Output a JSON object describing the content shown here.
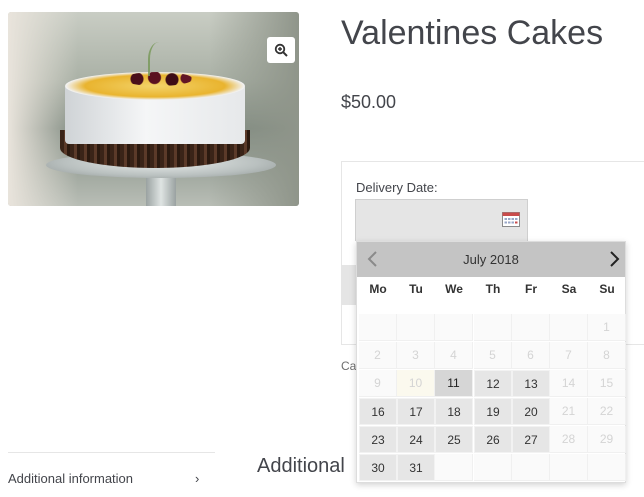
{
  "product": {
    "title": "Valentines Cakes",
    "price": "$50.00",
    "image_alt": "cake"
  },
  "addon": {
    "delivery_label": "Delivery Date:",
    "date_value": ""
  },
  "meta": {
    "category_fragment": "Cat"
  },
  "tabs": {
    "additional_information": "Additional information",
    "chevron": "›"
  },
  "section_heading": "Additional",
  "datepicker": {
    "month_title": "July 2018",
    "weekdays": [
      "Mo",
      "Tu",
      "We",
      "Th",
      "Fr",
      "Sa",
      "Su"
    ],
    "weeks": [
      [
        {
          "t": "",
          "s": "empty"
        },
        {
          "t": "",
          "s": "empty"
        },
        {
          "t": "",
          "s": "empty"
        },
        {
          "t": "",
          "s": "empty"
        },
        {
          "t": "",
          "s": "empty"
        },
        {
          "t": "",
          "s": "empty"
        },
        {
          "t": "1",
          "s": "disabled"
        }
      ],
      [
        {
          "t": "2",
          "s": "disabled"
        },
        {
          "t": "3",
          "s": "disabled"
        },
        {
          "t": "4",
          "s": "disabled"
        },
        {
          "t": "5",
          "s": "disabled"
        },
        {
          "t": "6",
          "s": "disabled"
        },
        {
          "t": "7",
          "s": "disabled"
        },
        {
          "t": "8",
          "s": "disabled"
        }
      ],
      [
        {
          "t": "9",
          "s": "disabled"
        },
        {
          "t": "10",
          "s": "today"
        },
        {
          "t": "11",
          "s": "selected"
        },
        {
          "t": "12",
          "s": "available"
        },
        {
          "t": "13",
          "s": "available"
        },
        {
          "t": "14",
          "s": "disabled"
        },
        {
          "t": "15",
          "s": "disabled"
        }
      ],
      [
        {
          "t": "16",
          "s": "available"
        },
        {
          "t": "17",
          "s": "available"
        },
        {
          "t": "18",
          "s": "available"
        },
        {
          "t": "19",
          "s": "available"
        },
        {
          "t": "20",
          "s": "available"
        },
        {
          "t": "21",
          "s": "disabled"
        },
        {
          "t": "22",
          "s": "disabled"
        }
      ],
      [
        {
          "t": "23",
          "s": "available"
        },
        {
          "t": "24",
          "s": "available"
        },
        {
          "t": "25",
          "s": "available"
        },
        {
          "t": "26",
          "s": "available"
        },
        {
          "t": "27",
          "s": "available"
        },
        {
          "t": "28",
          "s": "disabled"
        },
        {
          "t": "29",
          "s": "disabled"
        }
      ],
      [
        {
          "t": "30",
          "s": "available"
        },
        {
          "t": "31",
          "s": "available"
        },
        {
          "t": "",
          "s": "empty"
        },
        {
          "t": "",
          "s": "empty"
        },
        {
          "t": "",
          "s": "empty"
        },
        {
          "t": "",
          "s": "empty"
        },
        {
          "t": "",
          "s": "empty"
        }
      ]
    ]
  },
  "colors": {
    "header_bg": "#c4c4c4",
    "available_bg": "#e6e6e6",
    "text": "#43454b"
  }
}
